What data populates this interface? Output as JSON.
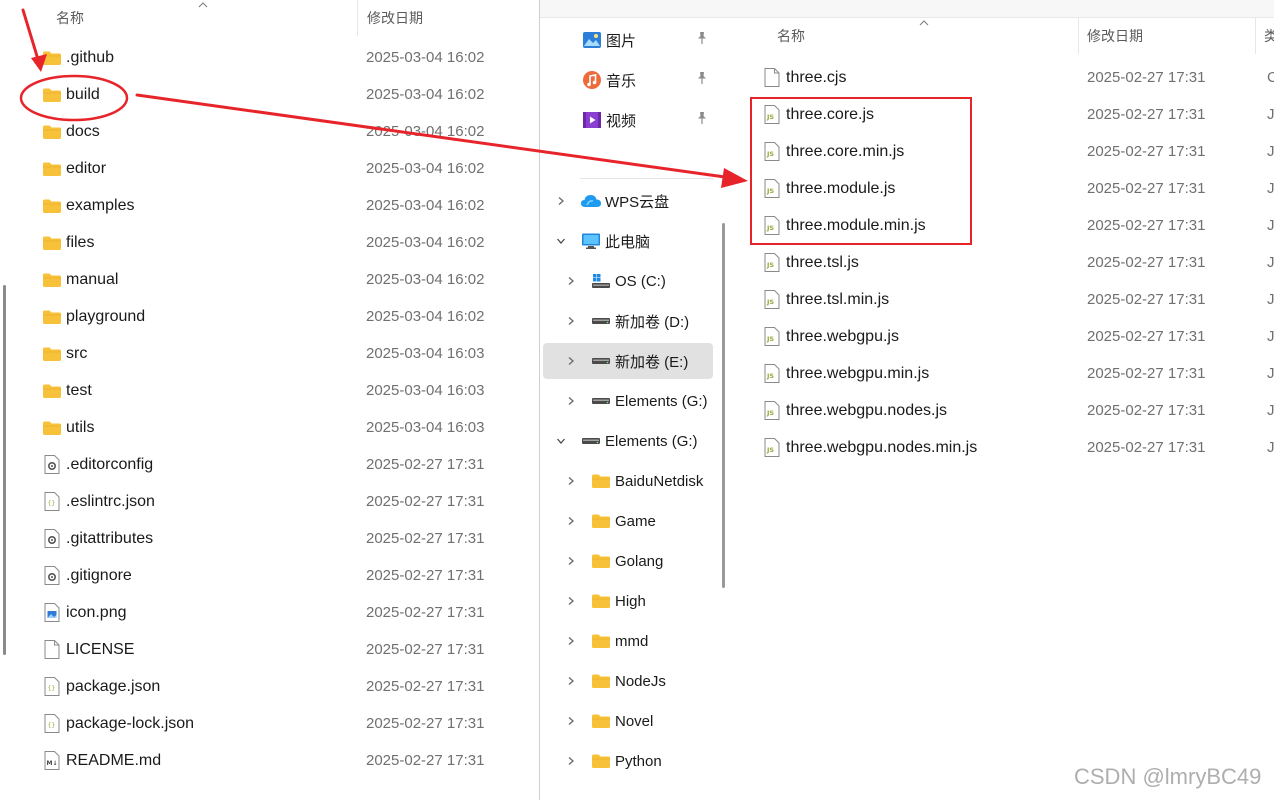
{
  "left": {
    "header": {
      "name": "名称",
      "date": "修改日期"
    },
    "rows": [
      {
        "name": ".github",
        "date": "2025-03-04 16:02",
        "icon": "folder-icon"
      },
      {
        "name": "build",
        "date": "2025-03-04 16:02",
        "icon": "folder-icon"
      },
      {
        "name": "docs",
        "date": "2025-03-04 16:02",
        "icon": "folder-icon"
      },
      {
        "name": "editor",
        "date": "2025-03-04 16:02",
        "icon": "folder-icon"
      },
      {
        "name": "examples",
        "date": "2025-03-04 16:02",
        "icon": "folder-icon"
      },
      {
        "name": "files",
        "date": "2025-03-04 16:02",
        "icon": "folder-icon"
      },
      {
        "name": "manual",
        "date": "2025-03-04 16:02",
        "icon": "folder-icon"
      },
      {
        "name": "playground",
        "date": "2025-03-04 16:02",
        "icon": "folder-icon"
      },
      {
        "name": "src",
        "date": "2025-03-04 16:03",
        "icon": "folder-icon"
      },
      {
        "name": "test",
        "date": "2025-03-04 16:03",
        "icon": "folder-icon"
      },
      {
        "name": "utils",
        "date": "2025-03-04 16:03",
        "icon": "folder-icon"
      },
      {
        "name": ".editorconfig",
        "date": "2025-02-27 17:31",
        "icon": "config-file-icon"
      },
      {
        "name": ".eslintrc.json",
        "date": "2025-02-27 17:31",
        "icon": "json-file-icon"
      },
      {
        "name": ".gitattributes",
        "date": "2025-02-27 17:31",
        "icon": "config-file-icon"
      },
      {
        "name": ".gitignore",
        "date": "2025-02-27 17:31",
        "icon": "config-file-icon"
      },
      {
        "name": "icon.png",
        "date": "2025-02-27 17:31",
        "icon": "image-file-icon"
      },
      {
        "name": "LICENSE",
        "date": "2025-02-27 17:31",
        "icon": "blank-file-icon"
      },
      {
        "name": "package.json",
        "date": "2025-02-27 17:31",
        "icon": "json-file-icon"
      },
      {
        "name": "package-lock.json",
        "date": "2025-02-27 17:31",
        "icon": "json-file-icon"
      },
      {
        "name": "README.md",
        "date": "2025-02-27 17:31",
        "icon": "markdown-file-icon"
      }
    ]
  },
  "nav": {
    "quick_access": [
      {
        "label": "图片",
        "icon": "pictures-icon"
      },
      {
        "label": "音乐",
        "icon": "music-icon"
      },
      {
        "label": "视频",
        "icon": "videos-icon"
      }
    ],
    "tree": [
      {
        "label": "WPS云盘",
        "icon": "cloud-icon",
        "expanded": false,
        "level": 0,
        "selected": false
      },
      {
        "label": "此电脑",
        "icon": "this-pc-icon",
        "expanded": true,
        "level": 0,
        "selected": false
      },
      {
        "label": "OS (C:)",
        "icon": "os-drive-icon",
        "expanded": false,
        "level": 1,
        "selected": false
      },
      {
        "label": "新加卷 (D:)",
        "icon": "drive-icon",
        "expanded": false,
        "level": 1,
        "selected": false
      },
      {
        "label": "新加卷 (E:)",
        "icon": "drive-icon",
        "expanded": false,
        "level": 1,
        "selected": true
      },
      {
        "label": "Elements (G:)",
        "icon": "drive-icon",
        "expanded": false,
        "level": 1,
        "selected": false
      },
      {
        "label": "Elements (G:)",
        "icon": "drive-icon",
        "expanded": true,
        "level": 0,
        "selected": false
      },
      {
        "label": "BaiduNetdisk",
        "icon": "folder-icon",
        "expanded": false,
        "level": 1,
        "selected": false
      },
      {
        "label": "Game",
        "icon": "folder-icon",
        "expanded": false,
        "level": 1,
        "selected": false
      },
      {
        "label": "Golang",
        "icon": "folder-icon",
        "expanded": false,
        "level": 1,
        "selected": false
      },
      {
        "label": "High",
        "icon": "folder-icon",
        "expanded": false,
        "level": 1,
        "selected": false
      },
      {
        "label": "mmd",
        "icon": "folder-icon",
        "expanded": false,
        "level": 1,
        "selected": false
      },
      {
        "label": "NodeJs",
        "icon": "folder-icon",
        "expanded": false,
        "level": 1,
        "selected": false
      },
      {
        "label": "Novel",
        "icon": "folder-icon",
        "expanded": false,
        "level": 1,
        "selected": false
      },
      {
        "label": "Python",
        "icon": "folder-icon",
        "expanded": false,
        "level": 1,
        "selected": false
      }
    ]
  },
  "right": {
    "header": {
      "name": "名称",
      "date": "修改日期",
      "type": "类"
    },
    "rows": [
      {
        "name": "three.cjs",
        "date": "2025-02-27 17:31",
        "type": "C",
        "icon": "blank-file-icon"
      },
      {
        "name": "three.core.js",
        "date": "2025-02-27 17:31",
        "type": "Ja",
        "icon": "js-file-icon"
      },
      {
        "name": "three.core.min.js",
        "date": "2025-02-27 17:31",
        "type": "Ja",
        "icon": "js-file-icon"
      },
      {
        "name": "three.module.js",
        "date": "2025-02-27 17:31",
        "type": "Ja",
        "icon": "js-file-icon"
      },
      {
        "name": "three.module.min.js",
        "date": "2025-02-27 17:31",
        "type": "Ja",
        "icon": "js-file-icon"
      },
      {
        "name": "three.tsl.js",
        "date": "2025-02-27 17:31",
        "type": "Ja",
        "icon": "js-file-icon"
      },
      {
        "name": "three.tsl.min.js",
        "date": "2025-02-27 17:31",
        "type": "Ja",
        "icon": "js-file-icon"
      },
      {
        "name": "three.webgpu.js",
        "date": "2025-02-27 17:31",
        "type": "Ja",
        "icon": "js-file-icon"
      },
      {
        "name": "three.webgpu.min.js",
        "date": "2025-02-27 17:31",
        "type": "Ja",
        "icon": "js-file-icon"
      },
      {
        "name": "three.webgpu.nodes.js",
        "date": "2025-02-27 17:31",
        "type": "Ja",
        "icon": "js-file-icon"
      },
      {
        "name": "three.webgpu.nodes.min.js",
        "date": "2025-02-27 17:31",
        "type": "Ja",
        "icon": "js-file-icon"
      }
    ]
  },
  "annotations": {
    "color": "#e8242b",
    "highlighted_folder": "build",
    "highlighted_files": [
      "three.core.js",
      "three.core.min.js",
      "three.module.js",
      "three.module.min.js"
    ]
  },
  "watermark": "CSDN @lmryBC49",
  "colors": {
    "folder": "#f7c23a",
    "folder_tab": "#e9a826",
    "js_badge": "#9aa53a",
    "selection": "#e1e1e1"
  }
}
